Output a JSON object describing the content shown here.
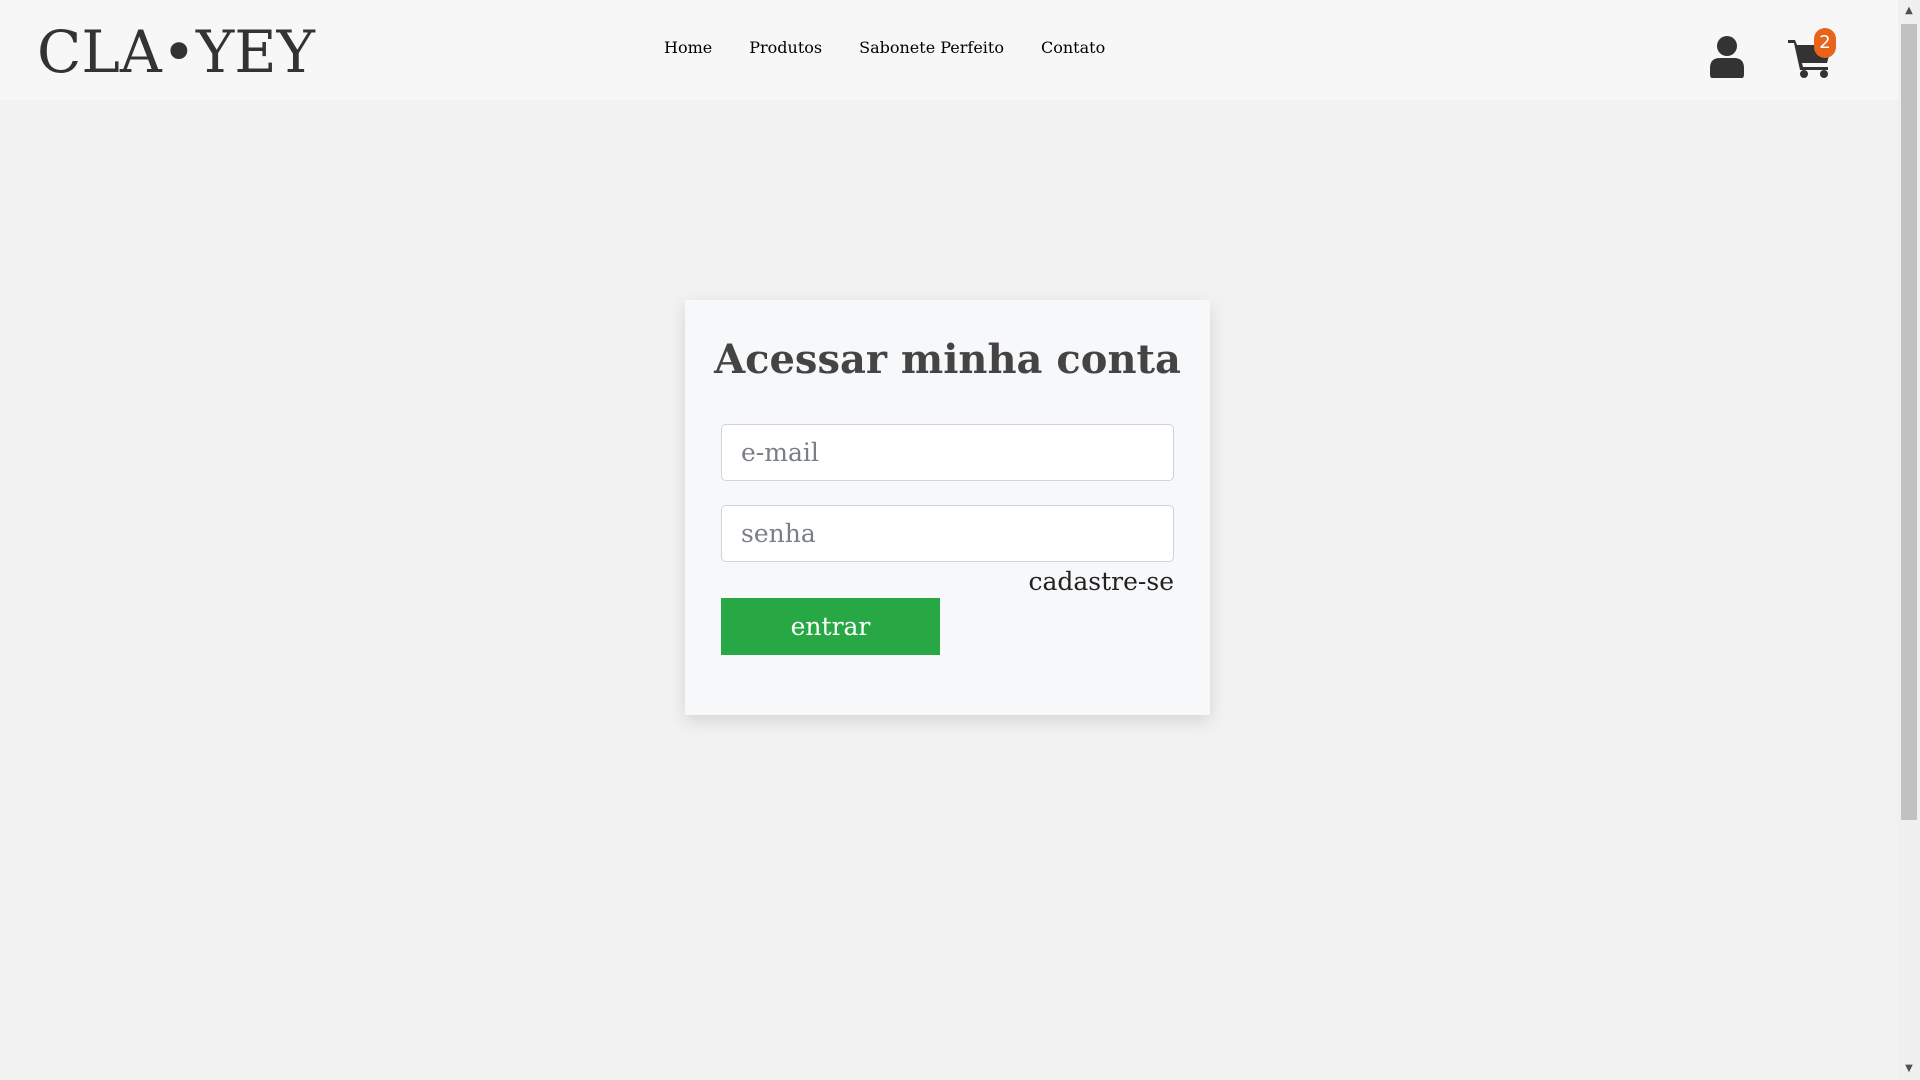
{
  "brand": {
    "logo_text": "CLA•YEY"
  },
  "nav": {
    "items": [
      {
        "label": "Home"
      },
      {
        "label": "Produtos"
      },
      {
        "label": "Sabonete Perfeito"
      },
      {
        "label": "Contato"
      }
    ]
  },
  "header_icons": {
    "user_icon": "user-icon",
    "cart_icon": "shopping-cart-icon",
    "cart_count": "2"
  },
  "login": {
    "title": "Acessar minha conta",
    "email_placeholder": "e-mail",
    "password_placeholder": "senha",
    "signup_link": "cadastre-se",
    "submit_label": "entrar"
  },
  "colors": {
    "page_background": "#f2f2f2",
    "header_background": "#f7f7f7",
    "submit_button": "#28a745",
    "cart_badge": "#e8641b",
    "text_dark": "#333333"
  }
}
